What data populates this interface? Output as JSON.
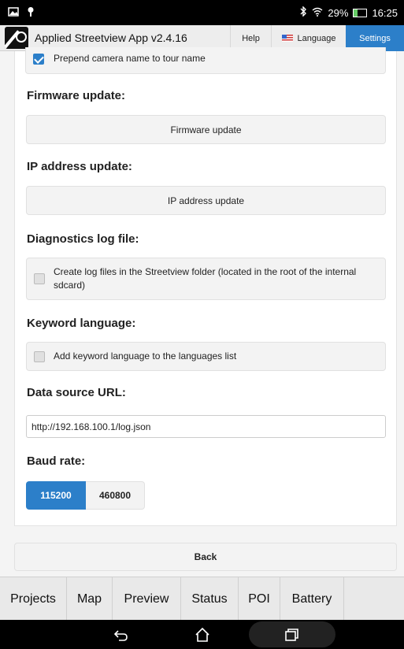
{
  "status_bar": {
    "battery": "29%",
    "time": "16:25"
  },
  "header": {
    "title": "Applied Streetview App v2.4.16",
    "help": "Help",
    "language": "Language",
    "settings": "Settings"
  },
  "settings": {
    "prepend_label": "Prepend camera name to tour name",
    "prepend_checked": true,
    "firmware_title": "Firmware update:",
    "firmware_button": "Firmware update",
    "ip_title": "IP address update:",
    "ip_button": "IP address update",
    "diag_title": "Diagnostics log file:",
    "diag_label": "Create log files in the Streetview folder (located in the root of the internal sdcard)",
    "diag_checked": false,
    "keyword_title": "Keyword language:",
    "keyword_label": "Add keyword language to the languages list",
    "keyword_checked": false,
    "datasource_title": "Data source URL:",
    "datasource_value": "http://192.168.100.1/log.json",
    "baud_title": "Baud rate:",
    "baud_options": [
      "115200",
      "460800"
    ],
    "baud_selected": "115200",
    "back": "Back"
  },
  "tabs": [
    "Projects",
    "Map",
    "Preview",
    "Status",
    "POI",
    "Battery"
  ],
  "colors": {
    "accent": "#2c7fc9"
  }
}
